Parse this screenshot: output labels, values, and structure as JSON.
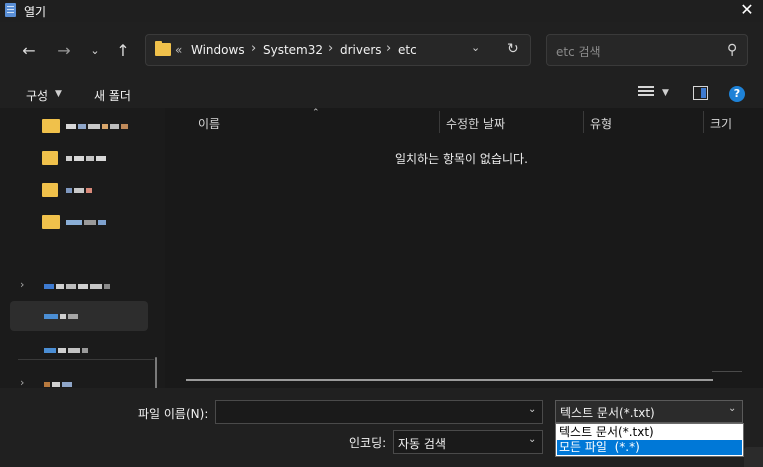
{
  "window": {
    "title": "열기"
  },
  "nav": {
    "path": [
      "Windows",
      "System32",
      "drivers",
      "etc"
    ],
    "overflow": "«",
    "search_placeholder": "etc 검색"
  },
  "toolbar": {
    "organize_label": "구성",
    "new_folder_label": "새 폴더"
  },
  "columns": [
    "이름",
    "수정한 날짜",
    "유형",
    "크기"
  ],
  "empty_message": "일치하는 항목이 없습니다.",
  "bottom": {
    "filename_label": "파일 이름(N):",
    "filename_value": "",
    "filetype_value": "텍스트 문서(*.txt)",
    "encoding_label": "인코딩:",
    "encoding_value": "자동 검색",
    "filetype_options": [
      "텍스트 문서(*.txt)",
      "모든 파일  (*.*)"
    ]
  },
  "colors": {
    "accent": "#0078d7",
    "folder": "#f0c14b"
  },
  "icons": [
    "notepad-icon",
    "close-icon",
    "back-icon",
    "forward-icon",
    "recent-chevron-icon",
    "up-arrow-icon",
    "folder-icon",
    "refresh-icon",
    "search-icon",
    "view-list-icon",
    "preview-pane-icon",
    "help-icon"
  ]
}
